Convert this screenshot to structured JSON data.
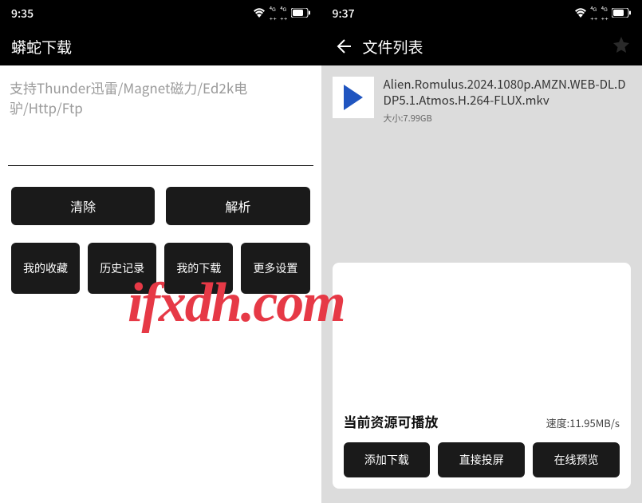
{
  "left": {
    "status_time": "9:35",
    "title": "蟒蛇下载",
    "placeholder": "支持Thunder迅雷/Magnet磁力/Ed2k电驴/Http/Ftp",
    "clear": "清除",
    "parse": "解析",
    "fav": "我的收藏",
    "history": "历史记录",
    "downloads": "我的下载",
    "more": "更多设置"
  },
  "right": {
    "status_time": "9:37",
    "title": "文件列表",
    "file_name": "Alien.Romulus.2024.1080p.AMZN.WEB-DL.DDP5.1.Atmos.H.264-FLUX.mkv",
    "file_size_label": "大小:7.99GB",
    "card_status": "当前资源可播放",
    "card_speed": "速度:11.95MB/s",
    "add_dl": "添加下载",
    "cast": "直接投屏",
    "preview": "在线预览"
  },
  "watermark": "ifxdh.com"
}
